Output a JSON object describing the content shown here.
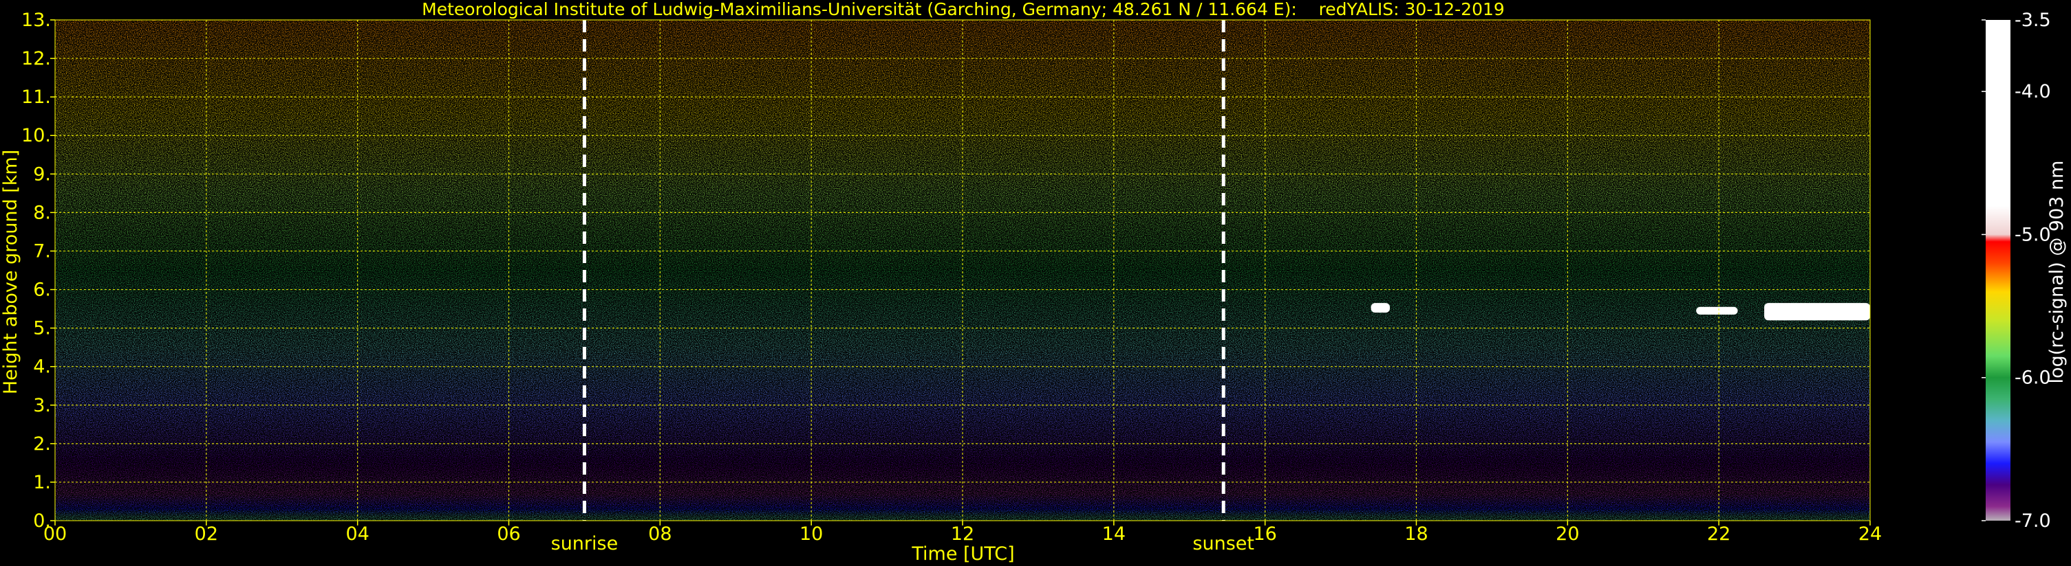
{
  "chart_data": {
    "type": "heatmap",
    "title": "Meteorological Institute of Ludwig-Maximilians-Universität (Garching, Germany; 48.261 N / 11.664 E):    redYALIS: 30-12-2019",
    "xlabel": "Time [UTC]",
    "ylabel": "Height above ground [km]",
    "xlim": [
      0,
      24
    ],
    "ylim": [
      0,
      13
    ],
    "x_ticks": [
      {
        "value": 0,
        "label": "00"
      },
      {
        "value": 2,
        "label": "02"
      },
      {
        "value": 4,
        "label": "04"
      },
      {
        "value": 6,
        "label": "06"
      },
      {
        "value": 8,
        "label": "08"
      },
      {
        "value": 10,
        "label": "10"
      },
      {
        "value": 12,
        "label": "12"
      },
      {
        "value": 14,
        "label": "14"
      },
      {
        "value": 16,
        "label": "16"
      },
      {
        "value": 18,
        "label": "18"
      },
      {
        "value": 20,
        "label": "20"
      },
      {
        "value": 22,
        "label": "22"
      },
      {
        "value": 24,
        "label": "24"
      }
    ],
    "y_ticks": [
      {
        "value": 0,
        "label": "0."
      },
      {
        "value": 1,
        "label": "1."
      },
      {
        "value": 2,
        "label": "2."
      },
      {
        "value": 3,
        "label": "3."
      },
      {
        "value": 4,
        "label": "4."
      },
      {
        "value": 5,
        "label": "5."
      },
      {
        "value": 6,
        "label": "6."
      },
      {
        "value": 7,
        "label": "7."
      },
      {
        "value": 8,
        "label": "8."
      },
      {
        "value": 9,
        "label": "9."
      },
      {
        "value": 10,
        "label": "10."
      },
      {
        "value": 11,
        "label": "11."
      },
      {
        "value": 12,
        "label": "12."
      },
      {
        "value": 13,
        "label": "13."
      }
    ],
    "grid": true,
    "events": [
      {
        "time": 7.0,
        "label": "sunrise"
      },
      {
        "time": 15.45,
        "label": "sunset"
      }
    ],
    "colorbar": {
      "label": "log(rc-signal) @ 903 nm",
      "range": [
        -7.0,
        -3.5
      ],
      "ticks": [
        {
          "value": -3.5,
          "label": "-3.5"
        },
        {
          "value": -4.0,
          "label": "-4.0"
        },
        {
          "value": -5.0,
          "label": "-5.0"
        },
        {
          "value": -6.0,
          "label": "-6.0"
        },
        {
          "value": -7.0,
          "label": "-7.0"
        }
      ],
      "stops": [
        {
          "value": -7.0,
          "color": "#b8b0b8"
        },
        {
          "value": -6.9,
          "color": "#8c2a8c"
        },
        {
          "value": -6.75,
          "color": "#4b0082"
        },
        {
          "value": -6.6,
          "color": "#1a1aff"
        },
        {
          "value": -6.45,
          "color": "#7a8cff"
        },
        {
          "value": -6.3,
          "color": "#5ab4c8"
        },
        {
          "value": -6.15,
          "color": "#3cb371"
        },
        {
          "value": -6.0,
          "color": "#1e9a3c"
        },
        {
          "value": -5.85,
          "color": "#66dd66"
        },
        {
          "value": -5.6,
          "color": "#c8e628"
        },
        {
          "value": -5.4,
          "color": "#ffd700"
        },
        {
          "value": -5.2,
          "color": "#ff4500"
        },
        {
          "value": -5.05,
          "color": "#ff0000"
        },
        {
          "value": -5.0,
          "color": "#f0d0d0"
        },
        {
          "value": -4.8,
          "color": "#ffffff"
        },
        {
          "value": -3.5,
          "color": "#ffffff"
        }
      ]
    },
    "profile": [
      {
        "height": 0.1,
        "value": -6.2
      },
      {
        "height": 0.3,
        "value": -6.6
      },
      {
        "height": 0.7,
        "value": -6.9
      },
      {
        "height": 1.5,
        "value": -6.75
      },
      {
        "height": 3.0,
        "value": -6.5
      },
      {
        "height": 4.5,
        "value": -6.25
      },
      {
        "height": 6.5,
        "value": -6.0
      },
      {
        "height": 8.5,
        "value": -5.75
      },
      {
        "height": 10.5,
        "value": -5.45
      },
      {
        "height": 13.0,
        "value": -5.3
      }
    ],
    "cloud_layers": [
      {
        "t0": 17.4,
        "t1": 17.65,
        "h0": 5.4,
        "h1": 5.65
      },
      {
        "t0": 21.7,
        "t1": 22.25,
        "h0": 5.35,
        "h1": 5.55
      },
      {
        "t0": 22.6,
        "t1": 24.0,
        "h0": 5.2,
        "h1": 5.65
      }
    ],
    "colors": {
      "background": "#000000",
      "text": "#ffff00",
      "grid": "#ffff00",
      "event_line": "#ffffff",
      "colorbar_text": "#ffffff"
    }
  }
}
